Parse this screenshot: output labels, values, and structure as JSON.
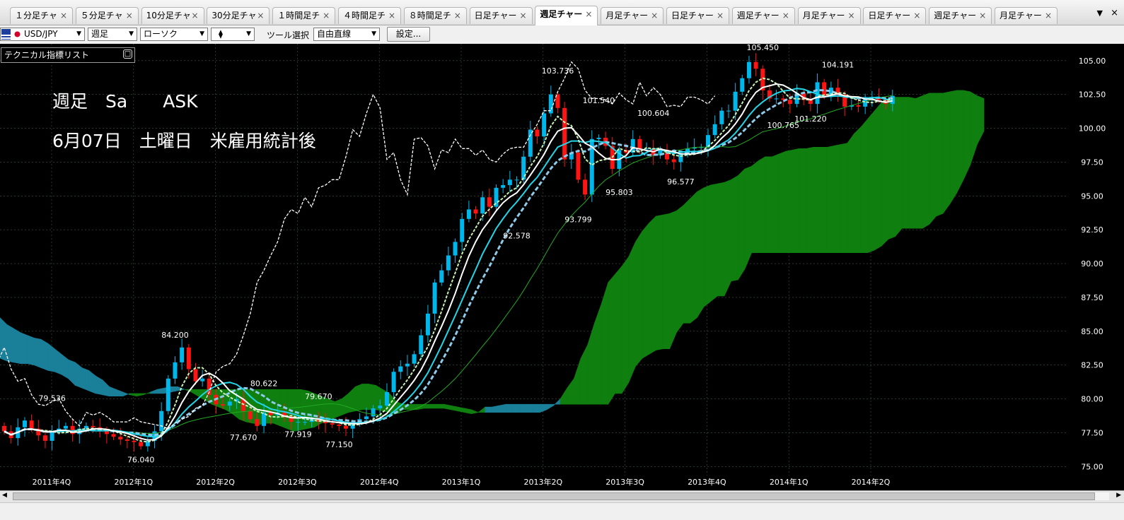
{
  "tabs": [
    {
      "label": "１分足チャ",
      "active": false
    },
    {
      "label": "５分足チャ",
      "active": false
    },
    {
      "label": "10分足チャ",
      "active": false
    },
    {
      "label": "30分足チャ",
      "active": false
    },
    {
      "label": "１時間足チ",
      "active": false
    },
    {
      "label": "４時間足チ",
      "active": false
    },
    {
      "label": "８時間足チ",
      "active": false
    },
    {
      "label": "日足チャー",
      "active": false
    },
    {
      "label": "週足チャー",
      "active": true
    },
    {
      "label": "月足チャー",
      "active": false
    },
    {
      "label": "日足チャー",
      "active": false
    },
    {
      "label": "週足チャー",
      "active": false
    },
    {
      "label": "月足チャー",
      "active": false
    },
    {
      "label": "日足チャー",
      "active": false
    },
    {
      "label": "週足チャー",
      "active": false
    },
    {
      "label": "月足チャー",
      "active": false
    }
  ],
  "tab_close_glyph": "×",
  "tab_menu_glyph": "▼",
  "toolbar": {
    "symbol": "USD/JPY",
    "period": "週足",
    "chart_type": "ローソク",
    "style_glyph": "⧫",
    "tool_label": "ツール選択",
    "tool_value": "自由直線",
    "settings_label": "設定..."
  },
  "indicator_panel": {
    "title": "テクニカル指標リスト",
    "button_glyph": "□"
  },
  "overlay": {
    "line1": "週足　Sa　　ASK",
    "line2": "6月07日　土曜日　米雇用統計後"
  },
  "colors": {
    "background": "#000000",
    "grid": "#3d5a3d",
    "candle_up": "#00b7eb",
    "candle_down": "#ff1414",
    "cloud": "#0f7f0f",
    "cloud_alt": "#1a7f99",
    "ma_white": "#ffffff",
    "ma_cyan": "#23d5e8",
    "ma_light_blue": "#8ecbea",
    "ma_green_dashed": "#c8f0b4",
    "chikou": "#ffffff",
    "ma_long": "#22aa22",
    "text": "#ffffff"
  },
  "chart_data": {
    "type": "candlestick",
    "instrument": "USD/JPY",
    "timeframe": "週足",
    "ylim": [
      74.0,
      106.2
    ],
    "y_ticks": [
      "105.00",
      "102.50",
      "100.00",
      "97.50",
      "95.00",
      "92.50",
      "90.00",
      "87.50",
      "85.00",
      "82.50",
      "80.00",
      "77.50",
      "75.00"
    ],
    "x_ticks": [
      "2011年4Q",
      "2012年1Q",
      "2012年2Q",
      "2012年3Q",
      "2012年4Q",
      "2013年1Q",
      "2013年2Q",
      "2013年3Q",
      "2013年4Q",
      "2014年1Q",
      "2014年2Q"
    ],
    "annotations": [
      {
        "label": "105.450",
        "value": 105.45,
        "week": 111
      },
      {
        "label": "104.191",
        "value": 104.191,
        "week": 122
      },
      {
        "label": "103.736",
        "value": 103.736,
        "week": 81
      },
      {
        "label": "101.540",
        "value": 101.54,
        "week": 87
      },
      {
        "label": "100.604",
        "value": 100.604,
        "week": 95
      },
      {
        "label": "100.765",
        "value": 100.765,
        "week": 114
      },
      {
        "label": "101.220",
        "value": 101.22,
        "week": 118
      },
      {
        "label": "96.577",
        "value": 96.577,
        "week": 99
      },
      {
        "label": "95.803",
        "value": 95.803,
        "week": 90
      },
      {
        "label": "93.799",
        "value": 93.799,
        "week": 84
      },
      {
        "label": "92.578",
        "value": 92.578,
        "week": 75
      },
      {
        "label": "84.200",
        "value": 84.2,
        "week": 25
      },
      {
        "label": "80.622",
        "value": 80.622,
        "week": 38
      },
      {
        "label": "79.670",
        "value": 79.67,
        "week": 46
      },
      {
        "label": "79.536",
        "value": 79.536,
        "week": 7
      },
      {
        "label": "77.670",
        "value": 77.67,
        "week": 35
      },
      {
        "label": "77.919",
        "value": 77.919,
        "week": 43
      },
      {
        "label": "77.150",
        "value": 77.15,
        "week": 49
      },
      {
        "label": "76.040",
        "value": 76.04,
        "week": 20
      }
    ],
    "closes": [
      77.6,
      77.1,
      77.9,
      78.4,
      77.8,
      77.3,
      76.9,
      77.6,
      77.8,
      78.0,
      77.4,
      77.8,
      78.0,
      77.9,
      77.7,
      77.4,
      77.2,
      77.0,
      76.9,
      76.8,
      76.5,
      76.9,
      77.6,
      79.1,
      81.5,
      82.7,
      83.8,
      82.2,
      81.3,
      81.5,
      80.3,
      79.6,
      79.5,
      79.8,
      80.0,
      79.1,
      78.5,
      78.0,
      79.0,
      78.8,
      79.0,
      78.7,
      78.3,
      78.3,
      78.3,
      78.6,
      78.3,
      78.2,
      78.1,
      78.0,
      77.8,
      78.2,
      78.5,
      78.7,
      79.3,
      79.5,
      80.5,
      82.0,
      82.4,
      82.6,
      83.3,
      84.7,
      86.3,
      88.6,
      89.5,
      90.6,
      91.6,
      93.3,
      94.0,
      93.7,
      94.9,
      94.2,
      95.6,
      95.8,
      96.2,
      96.2,
      97.9,
      99.9,
      99.4,
      101.1,
      102.5,
      101.5,
      97.7,
      98.2,
      96.2,
      95.1,
      99.2,
      99.3,
      98.7,
      97.0,
      98.4,
      98.2,
      99.2,
      98.5,
      98.5,
      98.0,
      98.4,
      97.7,
      97.5,
      98.1,
      98.5,
      98.6,
      98.6,
      99.5,
      100.3,
      101.3,
      101.3,
      102.7,
      103.7,
      104.9,
      104.4,
      102.8,
      102.2,
      102.2,
      102.1,
      101.8,
      102.6,
      102.1,
      101.8,
      103.4,
      102.4,
      103.0,
      102.5,
      101.6,
      101.7,
      101.6,
      102.3,
      102.3,
      102.1,
      101.8,
      102.4
    ],
    "cloud_upper": [
      83.0,
      82.8,
      82.7,
      82.6,
      82.6,
      82.5,
      82.3,
      82.1,
      82.0,
      81.8,
      81.5,
      81.0,
      80.8,
      80.6,
      80.4,
      80.3,
      80.2,
      80.2,
      80.2,
      80.4,
      80.4,
      80.4,
      80.4,
      80.4,
      80.4,
      80.5,
      80.6,
      80.7,
      80.7,
      80.7,
      80.7,
      80.7,
      80.7,
      80.7,
      80.7,
      80.7,
      80.7,
      80.7,
      80.7,
      80.7,
      80.7,
      80.7,
      80.7,
      80.7,
      80.7,
      80.6,
      80.4,
      80.2,
      80.0,
      79.8,
      80.0,
      80.4,
      80.9,
      81.1,
      81.1,
      81.0,
      80.7,
      80.4,
      79.8,
      79.6,
      79.6,
      79.6,
      79.6,
      79.6,
      79.6,
      79.6,
      79.5,
      79.4,
      79.3,
      79.2,
      79.0,
      79.0,
      79.0,
      79.0,
      79.0,
      79.0,
      79.0,
      79.0,
      79.0,
      79.0,
      79.2,
      79.5,
      80.0,
      80.8,
      81.5,
      83.0,
      84.0,
      85.6,
      87.0,
      88.6,
      89.2,
      89.8,
      90.5,
      91.6,
      92.4,
      93.0,
      93.5,
      93.6,
      93.7,
      93.9,
      94.3,
      94.8,
      95.3,
      95.6,
      95.8,
      95.9,
      96.0,
      96.2,
      96.5,
      97.0,
      97.2,
      97.6,
      97.9,
      97.9,
      98.1,
      98.3,
      98.4,
      98.5,
      98.5,
      98.6,
      98.6,
      98.6,
      98.7,
      98.8,
      98.9,
      99.6,
      100.1,
      100.7,
      101.3,
      101.9,
      102.2,
      102.3,
      102.3,
      102.3,
      102.2,
      102.4,
      102.6,
      102.6,
      102.6,
      102.7,
      102.8,
      102.8,
      102.7,
      102.4,
      102.2
    ],
    "cloud_lower": [
      86.0,
      85.5,
      85.2,
      84.9,
      84.7,
      84.5,
      84.4,
      84.1,
      83.7,
      83.3,
      82.9,
      82.7,
      82.3,
      82.1,
      81.7,
      81.4,
      80.9,
      80.7,
      80.5,
      80.3,
      80.2,
      80.3,
      80.5,
      80.7,
      80.8,
      80.9,
      80.9,
      80.7,
      80.5,
      80.2,
      79.9,
      79.6,
      79.4,
      79.2,
      78.9,
      78.5,
      78.3,
      78.2,
      78.1,
      78.2,
      78.2,
      78.0,
      77.8,
      77.6,
      77.7,
      77.8,
      77.9,
      78.2,
      78.4,
      78.6,
      78.8,
      79.0,
      79.1,
      79.2,
      79.2,
      79.2,
      79.1,
      79.0,
      78.9,
      79.2,
      79.2,
      79.2,
      79.3,
      79.3,
      79.3,
      79.3,
      79.2,
      79.1,
      79.0,
      78.9,
      79.0,
      79.4,
      79.4,
      79.5,
      79.6,
      79.6,
      79.6,
      79.6,
      79.6,
      79.6,
      79.6,
      79.6,
      79.6,
      79.6,
      79.6,
      79.6,
      79.6,
      79.6,
      79.6,
      79.6,
      80.4,
      80.4,
      81.2,
      82.4,
      83.0,
      83.3,
      83.6,
      83.7,
      83.7,
      84.9,
      85.6,
      85.6,
      86.0,
      86.8,
      87.2,
      87.6,
      87.6,
      88.7,
      88.8,
      89.6,
      90.8,
      90.8,
      90.8,
      90.8,
      90.8,
      90.8,
      90.8,
      90.8,
      90.8,
      90.8,
      90.8,
      90.8,
      90.8,
      90.8,
      90.8,
      90.8,
      90.8,
      90.8,
      91.0,
      91.3,
      91.8,
      92.0,
      92.6,
      92.6,
      92.6,
      92.6,
      92.9,
      93.5,
      93.7,
      94.4,
      95.2,
      96.2,
      97.3,
      98.8,
      99.8
    ]
  }
}
